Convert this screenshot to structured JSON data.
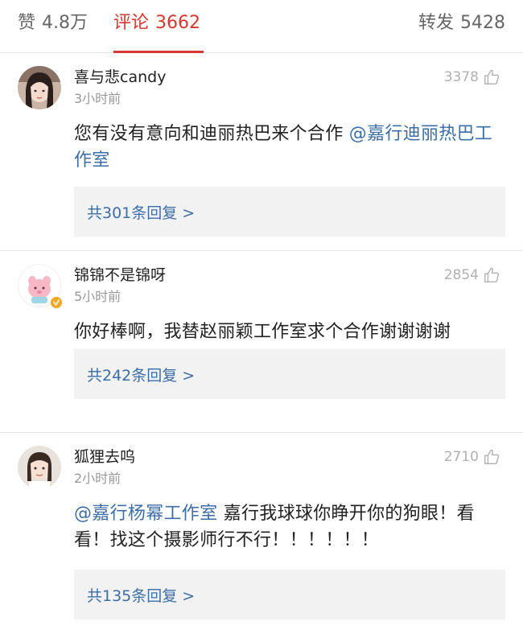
{
  "tabs": {
    "likes": {
      "label": "赞",
      "count": "4.8万"
    },
    "comments": {
      "label": "评论",
      "count": "3662"
    },
    "reposts": {
      "label": "转发",
      "count": "5428"
    }
  },
  "accent_color": "#d6382f",
  "link_color": "#3d6da5",
  "like_icon": "thumbs-up-icon",
  "comments": [
    {
      "username": "喜与悲candy",
      "time": "3小时前",
      "likes": "3378",
      "mention": "@嘉行迪丽热巴工作室",
      "text": "您有没有意向和迪丽热巴来个合作 ",
      "replies": "共301条回复 >"
    },
    {
      "username": "锦锦不是锦呀",
      "time": "5小时前",
      "likes": "2854",
      "text": "你好棒啊，我替赵丽颖工作室求个合作谢谢谢谢",
      "replies": "共242条回复 >"
    },
    {
      "username": "狐狸去呜",
      "time": "2小时前",
      "likes": "2710",
      "mention": "@嘉行杨幂工作室",
      "text": " 嘉行我球球你睁开你的狗眼！看看！找这个摄影师行不行！！！！！！",
      "replies": "共135条回复 >"
    }
  ]
}
